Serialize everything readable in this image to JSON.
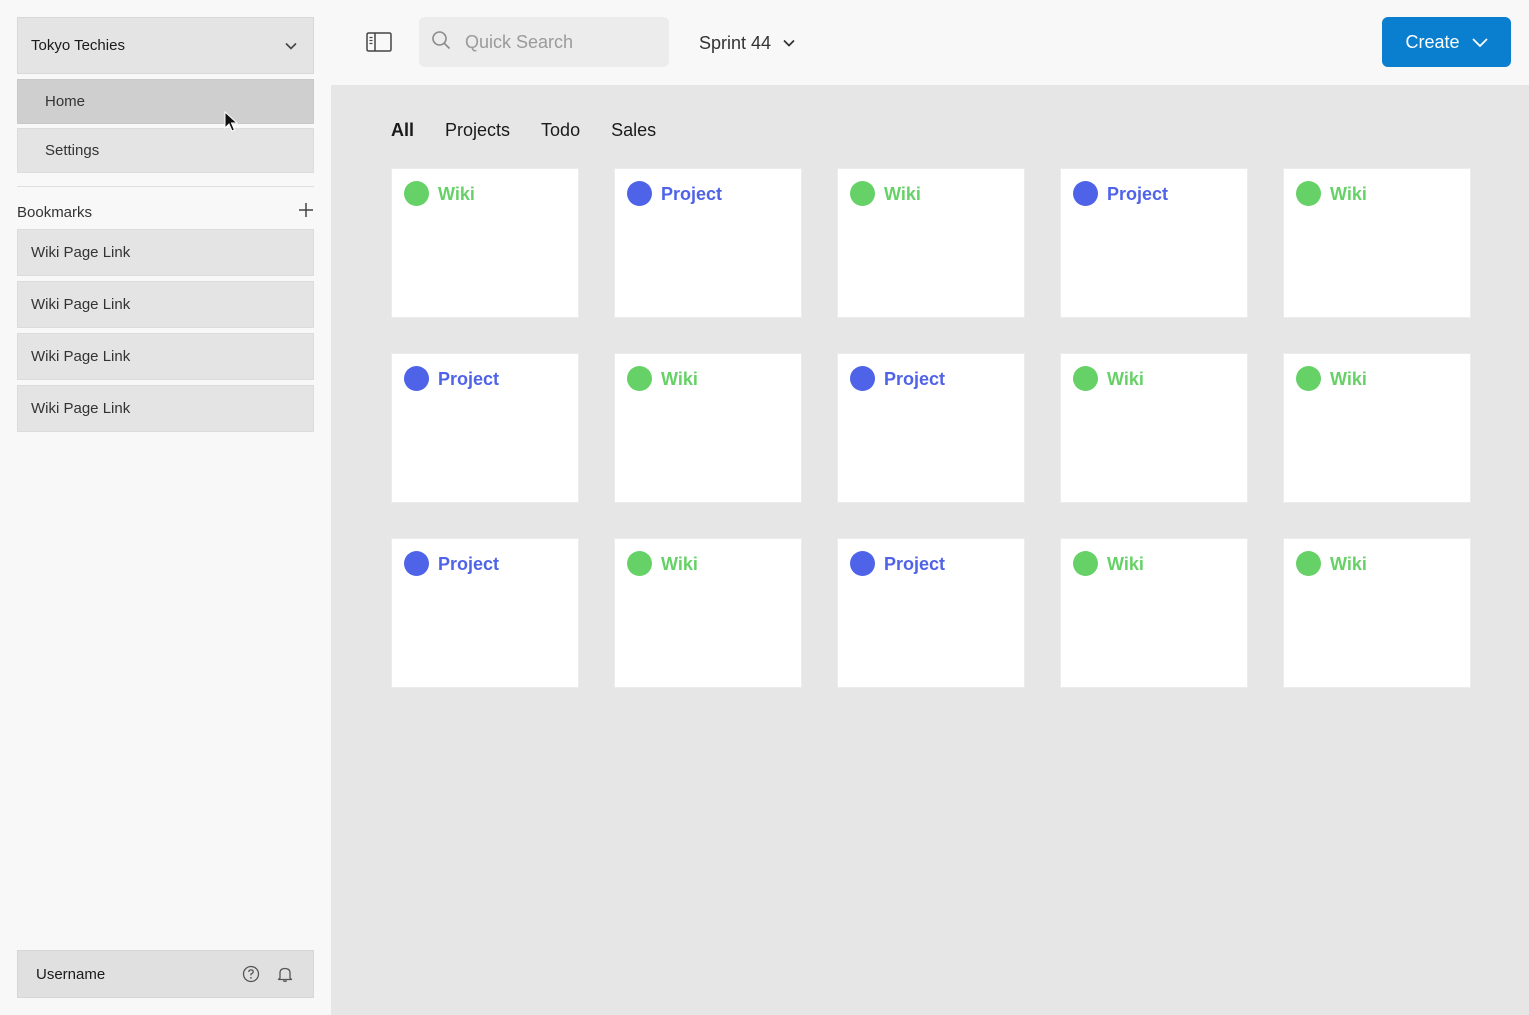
{
  "sidebar": {
    "workspace": "Tokyo Techies",
    "nav": [
      {
        "label": "Home",
        "active": true
      },
      {
        "label": "Settings",
        "active": false
      }
    ],
    "bookmarks_title": "Bookmarks",
    "bookmarks": [
      "Wiki Page Link",
      "Wiki Page Link",
      "Wiki Page Link",
      "Wiki Page Link"
    ],
    "user": "Username"
  },
  "topbar": {
    "search_placeholder": "Quick Search",
    "sprint": "Sprint 44",
    "create_label": "Create"
  },
  "tabs": [
    "All",
    "Projects",
    "Todo",
    "Sales"
  ],
  "active_tab": "All",
  "colors": {
    "wiki": "#66d166",
    "project": "#4f63e8",
    "accent": "#0b7fcf"
  },
  "cards": [
    {
      "label": "Wiki",
      "type": "wiki"
    },
    {
      "label": "Project",
      "type": "project"
    },
    {
      "label": "Wiki",
      "type": "wiki"
    },
    {
      "label": "Project",
      "type": "project"
    },
    {
      "label": "Wiki",
      "type": "wiki"
    },
    {
      "label": "Project",
      "type": "project"
    },
    {
      "label": "Wiki",
      "type": "wiki"
    },
    {
      "label": "Project",
      "type": "project"
    },
    {
      "label": "Wiki",
      "type": "wiki"
    },
    {
      "label": "Wiki",
      "type": "wiki"
    },
    {
      "label": "Project",
      "type": "project"
    },
    {
      "label": "Wiki",
      "type": "wiki"
    },
    {
      "label": "Project",
      "type": "project"
    },
    {
      "label": "Wiki",
      "type": "wiki"
    },
    {
      "label": "Wiki",
      "type": "wiki"
    }
  ]
}
